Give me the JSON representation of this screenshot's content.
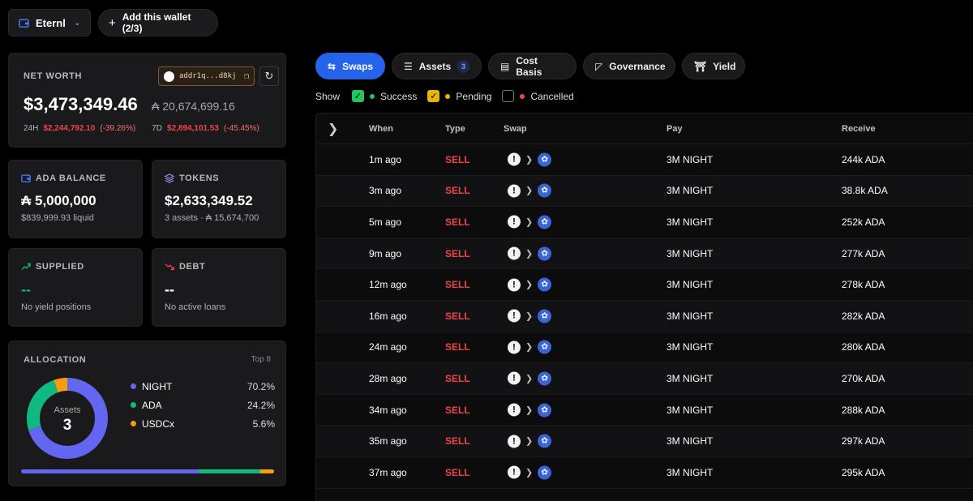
{
  "topbar": {
    "wallet_name": "Eternl",
    "add_wallet_label": "Add this wallet (2/3)"
  },
  "net_worth": {
    "label": "NET WORTH",
    "address": "addr1q...d8kj",
    "value": "$3,473,349.46",
    "ada_value": "₳ 20,674,699.16",
    "d24_label": "24H",
    "d24_value": "$2,244,792.10",
    "d24_pct": "(-39.26%)",
    "d7_label": "7D",
    "d7_value": "$2,894,101.53",
    "d7_pct": "(-45.45%)"
  },
  "ada_balance": {
    "label": "ADA BALANCE",
    "value": "₳ 5,000,000",
    "sub": "$839,999.93 liquid"
  },
  "tokens": {
    "label": "TOKENS",
    "value": "$2,633,349.52",
    "sub": "3 assets · ₳ 15,674,700"
  },
  "supplied": {
    "label": "SUPPLIED",
    "value": "--",
    "sub": "No yield positions"
  },
  "debt": {
    "label": "DEBT",
    "value": "--",
    "sub": "No active loans"
  },
  "allocation": {
    "label": "ALLOCATION",
    "top": "Top 8",
    "center_label": "Assets",
    "center_value": "3",
    "items": [
      {
        "name": "NIGHT",
        "pct": "70.2%",
        "share": 0.702,
        "color": "#6366f1"
      },
      {
        "name": "ADA",
        "pct": "24.2%",
        "share": 0.242,
        "color": "#10b981"
      },
      {
        "name": "USDCx",
        "pct": "5.6%",
        "share": 0.056,
        "color": "#f59e0b"
      }
    ]
  },
  "tabs": [
    {
      "label": "Swaps",
      "icon": "swap-icon",
      "active": true
    },
    {
      "label": "Assets",
      "icon": "list-icon",
      "badge": "3"
    },
    {
      "label": "Cost Basis",
      "icon": "receipt-icon"
    },
    {
      "label": "Governance",
      "icon": "vote-icon"
    },
    {
      "label": "Yield",
      "icon": "bank-icon"
    }
  ],
  "filters": {
    "show_label": "Show",
    "success": "Success",
    "pending": "Pending",
    "cancelled": "Cancelled",
    "colors": {
      "success": "#22c55e",
      "pending": "#eab308",
      "cancelled": "#ef4444"
    }
  },
  "table": {
    "headers": {
      "when": "When",
      "type": "Type",
      "swap": "Swap",
      "pay": "Pay",
      "receive": "Receive"
    },
    "rows": [
      {
        "when": "1m ago",
        "type": "SELL",
        "pay": "3M NIGHT",
        "receive": "244k ADA"
      },
      {
        "when": "3m ago",
        "type": "SELL",
        "pay": "3M NIGHT",
        "receive": "38.8k ADA"
      },
      {
        "when": "5m ago",
        "type": "SELL",
        "pay": "3M NIGHT",
        "receive": "252k ADA"
      },
      {
        "when": "9m ago",
        "type": "SELL",
        "pay": "3M NIGHT",
        "receive": "277k ADA"
      },
      {
        "when": "12m ago",
        "type": "SELL",
        "pay": "3M NIGHT",
        "receive": "278k ADA"
      },
      {
        "when": "16m ago",
        "type": "SELL",
        "pay": "3M NIGHT",
        "receive": "282k ADA"
      },
      {
        "when": "24m ago",
        "type": "SELL",
        "pay": "3M NIGHT",
        "receive": "280k ADA"
      },
      {
        "when": "28m ago",
        "type": "SELL",
        "pay": "3M NIGHT",
        "receive": "270k ADA"
      },
      {
        "when": "34m ago",
        "type": "SELL",
        "pay": "3M NIGHT",
        "receive": "288k ADA"
      },
      {
        "when": "35m ago",
        "type": "SELL",
        "pay": "3M NIGHT",
        "receive": "297k ADA"
      },
      {
        "when": "37m ago",
        "type": "SELL",
        "pay": "3M NIGHT",
        "receive": "295k ADA"
      }
    ]
  }
}
